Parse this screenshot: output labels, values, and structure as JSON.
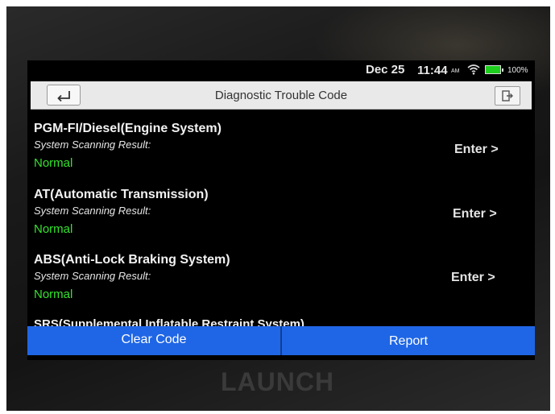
{
  "status_bar": {
    "date": "Dec 25",
    "time": "11:44",
    "ampm": "AM",
    "battery": "100%",
    "battery_color": "#1ecf1e"
  },
  "header": {
    "title": "Diagnostic Trouble Code",
    "back_icon": "back-arrow-icon",
    "exit_icon": "exit-icon"
  },
  "systems": [
    {
      "name": "PGM-FI/Diesel(Engine System)",
      "scan_label": "System Scanning Result:",
      "result": "Normal",
      "action": "Enter >"
    },
    {
      "name": "AT(Automatic Transmission)",
      "scan_label": "System Scanning Result:",
      "result": "Normal",
      "action": "Enter >"
    },
    {
      "name": "ABS(Anti-Lock Braking System)",
      "scan_label": "System Scanning Result:",
      "result": "Normal",
      "action": "Enter >"
    }
  ],
  "partial_system": "SRS(Supplemental Inflatable Restraint System)",
  "footer": {
    "clear_label": "Clear Code",
    "report_label": "Report",
    "accent_color": "#1f66e6"
  },
  "result_color": "#35e22e",
  "brand": "LAUNCH"
}
